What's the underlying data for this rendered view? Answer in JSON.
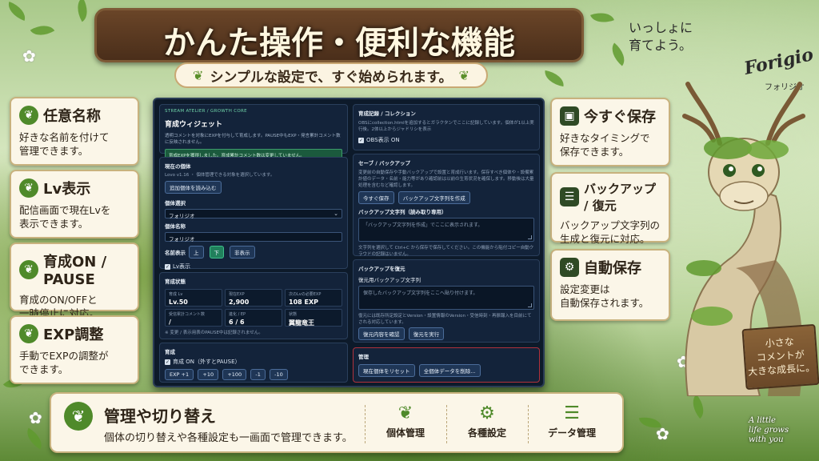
{
  "hero": {
    "title": "かんた操作・便利な機能",
    "subtitle": "シンプルな設定で、すぐ始められます。"
  },
  "left_cards": [
    {
      "title": "任意名称",
      "desc": "好きな名前を付けて\n管理できます。",
      "icon": "leaf-icon"
    },
    {
      "title": "Lv表示",
      "desc": "配信画面で現在Lvを\n表示できます。",
      "icon": "leaf-icon"
    },
    {
      "title": "育成ON / PAUSE",
      "desc": "育成のON/OFFと\n一時停止に対応。",
      "icon": "leaf-icon"
    },
    {
      "title": "EXP調整",
      "desc": "手動でEXPの調整が\nできます。",
      "icon": "leaf-icon"
    }
  ],
  "right_cards": [
    {
      "title": "今すぐ保存",
      "desc": "好きなタイミングで\n保存できます。",
      "icon": "save-icon"
    },
    {
      "title": "バックアップ / 復元",
      "desc": "バックアップ文字列の\n生成と復元に対応。",
      "icon": "database-icon"
    },
    {
      "title": "自動保存",
      "desc": "設定変更は\n自動保存されます。",
      "icon": "gear-icon"
    }
  ],
  "app": {
    "brand": "STREAM ATELIER / GROWTH CORE",
    "title": "育成ウィジェット",
    "desc": "透明コメントを対象にEXPを付与して育成します。PAUSE中もEXP・発言累計コメント数に反映されません。",
    "notice": "育成EXPを獲得しました。育成累計コメント数は変更していません。",
    "current": {
      "label": "現在の個体",
      "info": "Lovo v1.16 ・ 個体管理できる対象を選択しています。",
      "add_button": "追加個体を読み込む",
      "select_label": "個体選択",
      "select_value": "フォリジオ",
      "name_label": "個体名称",
      "name_value": "フォリジオ",
      "pos_label": "名前表示",
      "pos_options": [
        "上",
        "下",
        "非表示"
      ],
      "lv_toggle": "Lv表示"
    },
    "status": {
      "label": "育成状態",
      "stats": [
        {
          "label": "育成 Lv",
          "value": "Lv.50"
        },
        {
          "label": "現在EXP",
          "value": "2,900"
        },
        {
          "label": "次のLvの必要EXP",
          "value": "108 EXP"
        },
        {
          "label": "受信累計コメント数",
          "value": "/"
        },
        {
          "label": "進化 / EP",
          "value": "6 / 6"
        },
        {
          "label": "状態",
          "value": "翼龍竜王"
        }
      ],
      "note": "※ 変更 / 表示用表のPAUSE中は記録されません。"
    },
    "grow": {
      "label": "育成",
      "toggle": "育成 ON（外すとPAUSE）",
      "exp_buttons": [
        "EXP +1",
        "+10",
        "+100",
        "-1",
        "-10"
      ]
    },
    "record": {
      "label": "育成記録 / コレクション",
      "desc": "OBSにcollection.htmlを追加するとガラクタンでここに記録しています。個体が1以上実行後。2体以上からジャドリシを表示",
      "obs_toggle": "OBS表示 ON"
    },
    "backup": {
      "label": "セーブ / バックアップ",
      "desc": "変更前の自動保存や手動バックアップで設置と育成行います。保存すべき個体や・設備累計値のデータ・名前・能力等があり確認前は以前の生育状況を確保します。移動後は大量処理を含むなど確認します。",
      "save_button": "今すぐ保存",
      "make_button": "バックアップ文字列を作成",
      "text_label": "バックアップ文字列（読み取り専用）",
      "text_placeholder": "「バックアップ文字列を作成」でここに表示されます。",
      "note": "文字列を選択して Ctrl+C から保存で保存してください。この機能から貼付コピー自動クラウドの記録はいません。"
    },
    "restore": {
      "label": "バックアップを復元",
      "field_label": "復元用バックアップ文字列",
      "placeholder": "保存したバックアップ文字列をここへ貼り付けます。",
      "note": "復元には既存所定設定とVersion・設置情報のVersion・受信時刻・再振報入を目前にてされる対応しています。",
      "confirm_button": "復元内容を確認",
      "run_button": "復元を実行"
    },
    "manage": {
      "label": "管理",
      "reset_button": "現在個体をリセット",
      "delete_button": "全個体データを削除…"
    }
  },
  "bottom": {
    "title": "管理や切り替え",
    "desc": "個体の切り替えや各種設定も一画面で管理できます。",
    "items": [
      {
        "label": "個体管理",
        "icon": "sprout-icon"
      },
      {
        "label": "各種設定",
        "icon": "gear-icon"
      },
      {
        "label": "データ管理",
        "icon": "sliders-icon"
      }
    ]
  },
  "mascot": {
    "greeting": "いっしょに\n育てよう。",
    "logo": "Forigio",
    "logo_kana": "フォリジオ",
    "sign": "小さな\nコメントが\n大きな成長に。",
    "tagline": "A little\nlife grows\nwith you"
  },
  "colors": {
    "accent_green": "#4f8a2a",
    "panel_navy": "#0d1a2a",
    "banner_brown": "#5a3a20",
    "card_cream": "#fbf6e8"
  }
}
